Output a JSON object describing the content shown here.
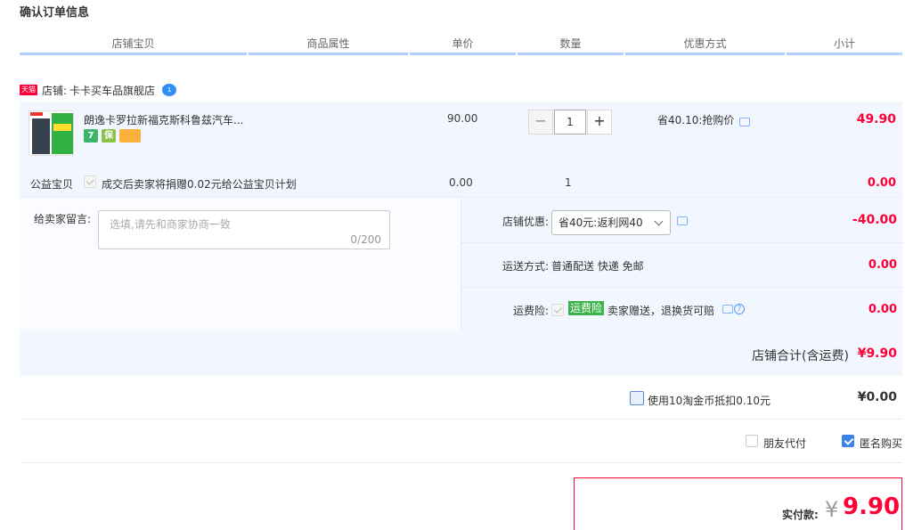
{
  "page_title": "确认订单信息",
  "columns": [
    "店铺宝贝",
    "商品属性",
    "单价",
    "数量",
    "优惠方式",
    "小计"
  ],
  "shop": {
    "badge": "天猫",
    "prefix": "店铺:",
    "name": "卡卡买车品旗舰店",
    "chat_icon_text": "1"
  },
  "item": {
    "title": "朗逸卡罗拉新福克斯科鲁兹汽车...",
    "badges": [
      "7",
      "保",
      ""
    ],
    "unit_price": "90.00",
    "quantity": "1",
    "qty_minus": "−",
    "qty_plus": "+",
    "discount": "省40.10:抢购价",
    "subtotal": "49.90"
  },
  "charity": {
    "label": "公益宝贝",
    "text": "成交后卖家将捐赠0.02元给公益宝贝计划",
    "price": "0.00",
    "quantity": "1",
    "subtotal": "0.00"
  },
  "message": {
    "label": "给卖家留言:",
    "placeholder": "选填,请先和商家协商一致",
    "counter": "0/200"
  },
  "options": {
    "shop_discount_label": "店铺优惠:",
    "shop_discount_value": "省40元:返利网40",
    "shop_discount_amount": "-40.00",
    "shipping_label": "运送方式:",
    "shipping_value": "普通配送 快递 免邮",
    "shipping_amount": "0.00",
    "insurance_label": "运费险:",
    "insurance_badge": "运费险",
    "insurance_text": "卖家赠送，退换货可赔",
    "insurance_help": "?",
    "insurance_amount": "0.00"
  },
  "shop_total": {
    "label": "店铺合计(含运费)",
    "value": "¥9.90"
  },
  "coins": {
    "text": "使用10淘金币抵扣0.10元",
    "value": "¥0.00"
  },
  "friend_pay": {
    "label": "朋友代付",
    "checked": false
  },
  "anonymous": {
    "label": "匿名购买",
    "checked": true
  },
  "payment": {
    "label": "实付款:",
    "currency": "¥",
    "amount": "9.90"
  },
  "colors": {
    "accent_red": "#ff0036",
    "header_line": "#b2d1ff",
    "row_bg": "#f2f7ff",
    "checkbox_blue": "#3c83e9",
    "insurance_green": "#3cb34a"
  }
}
